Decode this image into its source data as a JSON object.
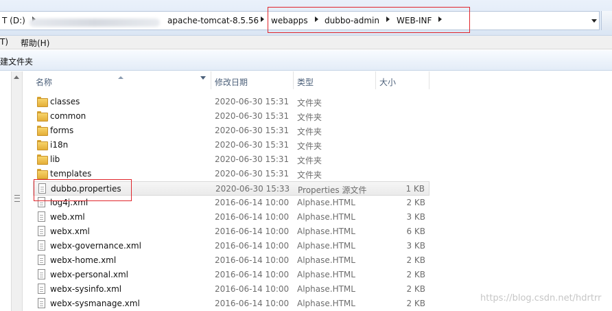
{
  "address_bar": {
    "drive_label": "T (D:)",
    "crumbs": [
      "apache-tomcat-8.5.56",
      "webapps",
      "dubbo-admin",
      "WEB-INF"
    ]
  },
  "menu": {
    "items": [
      "T)",
      "帮助(H)"
    ]
  },
  "toolbar": {
    "new_folder_label": "建文件夹"
  },
  "columns": {
    "name": "名称",
    "date": "修改日期",
    "type": "类型",
    "size": "大小"
  },
  "files": [
    {
      "name": "classes",
      "date": "2020-06-30 15:31",
      "type": "文件夹",
      "size": "",
      "kind": "folder"
    },
    {
      "name": "common",
      "date": "2020-06-30 15:31",
      "type": "文件夹",
      "size": "",
      "kind": "folder"
    },
    {
      "name": "forms",
      "date": "2020-06-30 15:31",
      "type": "文件夹",
      "size": "",
      "kind": "folder"
    },
    {
      "name": "i18n",
      "date": "2020-06-30 15:31",
      "type": "文件夹",
      "size": "",
      "kind": "folder"
    },
    {
      "name": "lib",
      "date": "2020-06-30 15:31",
      "type": "文件夹",
      "size": "",
      "kind": "folder"
    },
    {
      "name": "templates",
      "date": "2020-06-30 15:31",
      "type": "文件夹",
      "size": "",
      "kind": "folder"
    },
    {
      "name": "dubbo.properties",
      "date": "2020-06-30 15:33",
      "type": "Properties 源文件",
      "size": "1 KB",
      "kind": "file"
    },
    {
      "name": "log4j.xml",
      "date": "2016-06-14 10:00",
      "type": "Alphase.HTML",
      "size": "2 KB",
      "kind": "file"
    },
    {
      "name": "web.xml",
      "date": "2016-06-14 10:00",
      "type": "Alphase.HTML",
      "size": "3 KB",
      "kind": "file"
    },
    {
      "name": "webx.xml",
      "date": "2016-06-14 10:00",
      "type": "Alphase.HTML",
      "size": "6 KB",
      "kind": "file"
    },
    {
      "name": "webx-governance.xml",
      "date": "2016-06-14 10:00",
      "type": "Alphase.HTML",
      "size": "3 KB",
      "kind": "file"
    },
    {
      "name": "webx-home.xml",
      "date": "2016-06-14 10:00",
      "type": "Alphase.HTML",
      "size": "2 KB",
      "kind": "file"
    },
    {
      "name": "webx-personal.xml",
      "date": "2016-06-14 10:00",
      "type": "Alphase.HTML",
      "size": "2 KB",
      "kind": "file"
    },
    {
      "name": "webx-sysinfo.xml",
      "date": "2016-06-14 10:00",
      "type": "Alphase.HTML",
      "size": "2 KB",
      "kind": "file"
    },
    {
      "name": "webx-sysmanage.xml",
      "date": "2016-06-14 10:00",
      "type": "Alphase.HTML",
      "size": "2 KB",
      "kind": "file"
    }
  ],
  "watermark": "https://blog.csdn.net/hdrtrr",
  "colors": {
    "annotation_red": "#e0252b",
    "header_text": "#4c607a",
    "folder_yellow": "#f7d46b"
  }
}
